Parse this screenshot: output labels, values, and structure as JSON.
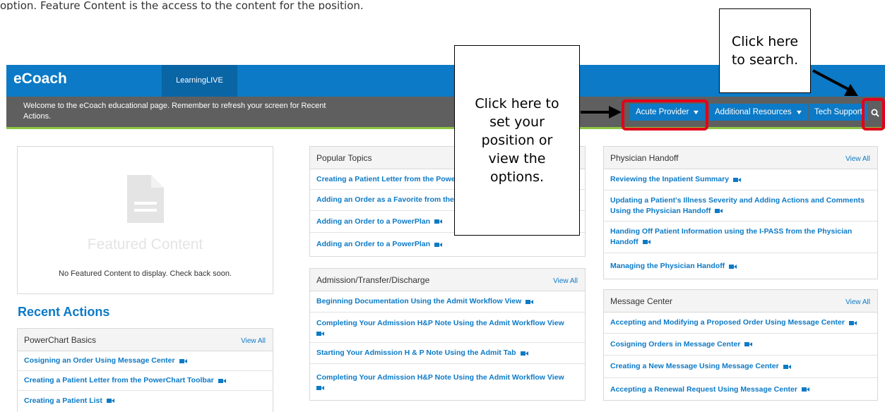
{
  "intro_text": "option. Feature Content is the access to the content for the position.",
  "header": {
    "logo": "eCoach",
    "tab_learning": "LearningLIVE",
    "welcome": "Welcome to the eCoach educational page. Remember to refresh your screen for Recent Actions."
  },
  "nav": {
    "position": "Acute Provider",
    "resources": "Additional Resources",
    "support": "Tech Support"
  },
  "callouts": {
    "position": "Click here to set your position or view the options.",
    "search": "Click here to search."
  },
  "featured": {
    "title": "Featured Content",
    "empty": "No Featured Content to display. Check back soon."
  },
  "recent_title": "Recent Actions",
  "view_all": "View All",
  "panels": {
    "powerchart": {
      "title": "PowerChart Basics",
      "items": [
        "Cosigning an Order Using Message Center",
        "Creating a Patient Letter from the PowerChart Toolbar",
        "Creating a Patient List"
      ]
    },
    "popular": {
      "title": "Popular Topics",
      "items": [
        "Creating a Patient Letter from the PowerChart Toolbar",
        "Adding an Order as a Favorite from the Order Profile",
        "Adding an Order to a PowerPlan",
        "Adding an Order to a PowerPlan"
      ]
    },
    "admission": {
      "title": "Admission/Transfer/Discharge",
      "items": [
        "Beginning Documentation Using the Admit Workflow View",
        "Completing Your Admission H&P Note Using the Admit Workflow View",
        "Starting Your Admission H & P Note Using the Admit Tab",
        "Completing Your Admission H&P Note Using the Admit Workflow View"
      ]
    },
    "handoff": {
      "title": "Physician Handoff",
      "items": [
        "Reviewing the Inpatient Summary",
        "Updating a Patient's Illness Severity and Adding Actions and Comments Using the Physician Handoff",
        "Handing Off Patient Information using the I-PASS from the Physician Handoff",
        "Managing the Physician Handoff"
      ]
    },
    "message": {
      "title": "Message Center",
      "items": [
        "Accepting and Modifying a Proposed Order Using Message Center",
        "Cosigning Orders in Message Center",
        "Creating a New Message Using Message Center",
        "Accepting a Renewal Request Using Message Center"
      ]
    }
  },
  "colors": {
    "brand_blue": "#0c7ac6",
    "bar_gray": "#5f5f5f",
    "accent_green": "#8cc641",
    "highlight_red": "#e2001a"
  },
  "icons": {
    "video": "video-camera-icon",
    "search": "search-icon",
    "chevron": "chevron-down-icon",
    "document": "document-icon"
  }
}
